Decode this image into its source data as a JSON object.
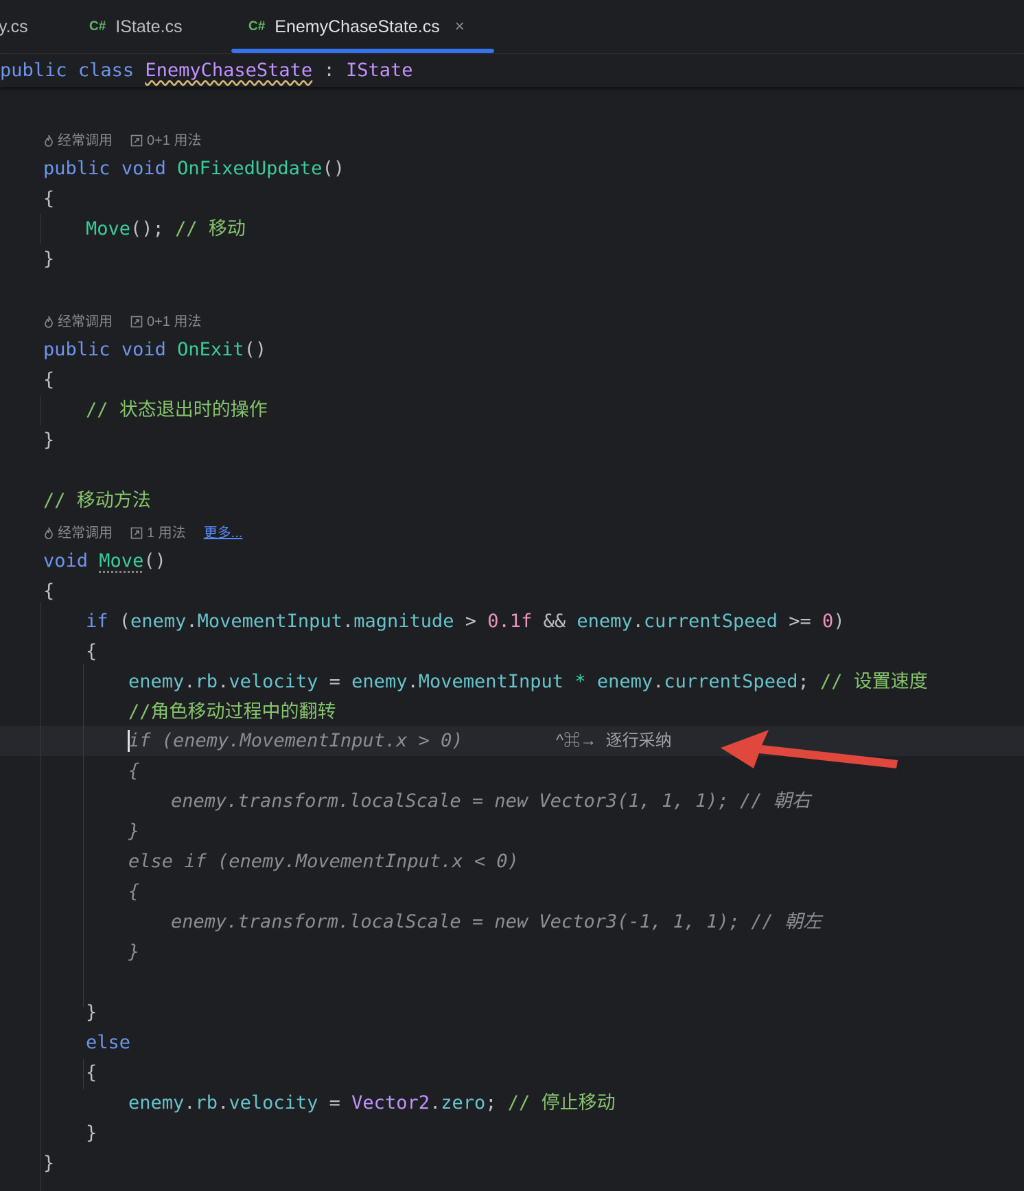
{
  "tabs": [
    {
      "icon": "",
      "label": "y.cs"
    },
    {
      "icon": "C#",
      "label": "IState.cs"
    },
    {
      "icon": "C#",
      "label": "EnemyChaseState.cs",
      "close": "×"
    }
  ],
  "sticky": {
    "public": "public",
    "class": "class",
    "name": "EnemyChaseState",
    "colon": ":",
    "iface": "IState"
  },
  "hints": {
    "frequent": "经常调用",
    "usages_01": "0+1 用法",
    "usages_1": "1 用法",
    "more": "更多..."
  },
  "code": {
    "public": "public",
    "void": "void",
    "on_fixed_update": "OnFixedUpdate",
    "parens": "()",
    "open_brace": "{",
    "close_brace": "}",
    "move_call": "Move",
    "call_end": "();",
    "cmt_move": "// 移动",
    "on_exit": "OnExit",
    "cmt_exit": "// 状态退出时的操作",
    "cmt_move_method": "// 移动方法",
    "move": "Move",
    "if": "if",
    "lparen": "(",
    "rparen": ")",
    "enemy": "enemy",
    "dot": ".",
    "movement_input": "MovementInput",
    "magnitude": "magnitude",
    "gt": ">",
    "num_01f": "0.1f",
    "and": "&&",
    "current_speed": "currentSpeed",
    "ge": ">=",
    "num_0": "0",
    "rb": "rb",
    "velocity": "velocity",
    "eq": "=",
    "mul": "*",
    "semi": ";",
    "cmt_set_speed": "// 设置速度",
    "cmt_flip": "//角色移动过程中的翻转",
    "ghost_if": "if (enemy.MovementInput.x > 0)",
    "ghost_open": "{",
    "ghost_right": "enemy.transform.localScale = new Vector3(1, 1, 1); // 朝右",
    "ghost_close": "}",
    "ghost_elseif": "else if (enemy.MovementInput.x < 0)",
    "ghost_left": "enemy.transform.localScale = new Vector3(-1, 1, 1); // 朝左",
    "else": "else",
    "vector2": "Vector2",
    "zero": "zero",
    "cmt_stop": "// 停止移动"
  },
  "accept_hint": {
    "keys": "^⌘→",
    "label": "逐行采纳"
  },
  "colors": {
    "background": "#1e1f22",
    "accent": "#3574f0",
    "arrow": "#e0483d"
  },
  "icons": [
    "fire-icon",
    "usages-icon",
    "close-icon",
    "arrow-annotation"
  ]
}
